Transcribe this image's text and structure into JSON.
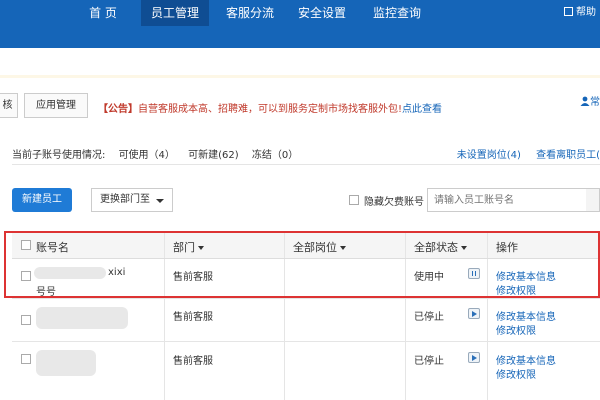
{
  "nav": {
    "items": [
      "首 页",
      "员工管理",
      "客服分流",
      "安全设置",
      "监控查询"
    ],
    "active_index": 1,
    "help": "帮助"
  },
  "subnav": {
    "tab_partial": "核",
    "tab_app": "应用管理",
    "notice_tag": "【公告】",
    "notice_text": "自营客服成本高、招聘难，可以到服务定制市场找客服外包!",
    "notice_link": "点此查看",
    "user_corner": "常"
  },
  "stats": {
    "label": "当前子账号使用情况:",
    "in_use": "可使用（4）",
    "new_created": "可新建(62)",
    "frozen": "冻结（0）",
    "unset_position": "未设置岗位(4)",
    "view_resigned": "查看离职员工("
  },
  "toolbar": {
    "new_button": "新建员工",
    "change_dept": "更换部门至",
    "hide_label": "隐藏欠费账号",
    "search_placeholder": "请输入员工账号名"
  },
  "table": {
    "headers": {
      "account": "账号名",
      "dept": "部门",
      "position": "全部岗位",
      "status": "全部状态",
      "ops": "操作"
    },
    "rows": [
      {
        "account_suffix": "xixi",
        "account_sub": "号号",
        "dept": "售前客服",
        "status": "使用中",
        "op1": "修改基本信息",
        "op2": "修改权限"
      },
      {
        "account_suffix": "",
        "account_sub": "",
        "dept": "售前客服",
        "status": "已停止",
        "op1": "修改基本信息",
        "op2": "修改权限"
      },
      {
        "account_suffix": "",
        "account_sub": "",
        "dept": "售前客服",
        "status": "已停止",
        "op1": "修改基本信息",
        "op2": "修改权限"
      }
    ]
  },
  "colors": {
    "nav_bg": "#1565b8",
    "primary_button": "#1f7bd6",
    "link": "#1565b8",
    "notice": "#c0392b",
    "highlight": "#dd3333"
  },
  "icons": [
    "help-icon",
    "user-icon",
    "caret-down-icon",
    "pause-icon",
    "play-icon",
    "search-icon"
  ]
}
